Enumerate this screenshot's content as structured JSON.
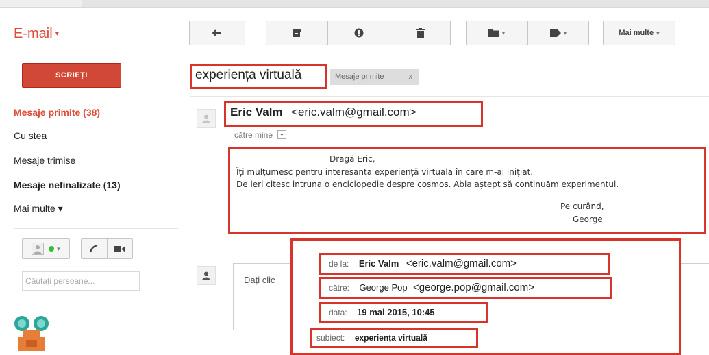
{
  "app": {
    "brand": "E-mail",
    "brand_caret": "▾"
  },
  "toolbar": {
    "more_label": "Mai multe",
    "more_caret": "▾",
    "caret": "▾",
    "icons": [
      "reply-arrow-icon",
      "archive-icon",
      "report-spam-icon",
      "trash-icon",
      "folder-icon",
      "label-tag-icon"
    ]
  },
  "sidebar": {
    "compose_label": "SCRIEȚI",
    "items": [
      {
        "label": "Mesaje primite (38)"
      },
      {
        "label": "Cu stea"
      },
      {
        "label": "Mesaje trimise"
      },
      {
        "label": "Mesaje nefinalizate (13)"
      },
      {
        "label": "Mai multe ▾"
      }
    ],
    "contacts_search_placeholder": "Căutați persoane..."
  },
  "conversation": {
    "subject": "experiența virtuală",
    "label_chip": "Mesaje primite",
    "label_chip_close": "x"
  },
  "message": {
    "sender_name": "Eric Valm",
    "sender_email": "<eric.valm@gmail.com>",
    "to_line": "către mine",
    "body": [
      "Dragă Eric,",
      "Îți mulțumesc pentru interesanta experiență virtuală în care m-ai inițiat.",
      "De ieri citesc intruna o enciclopedie despre cosmos. Abia aștept să continuăm experimentul.",
      "Pe curând,",
      "George"
    ]
  },
  "reply": {
    "placeholder": "Dați clic"
  },
  "details": {
    "from_label": "de la:",
    "from_name": "Eric Valm",
    "from_email": "<eric.valm@gmail.com>",
    "to_label": "către:",
    "to_name": "George Pop",
    "to_email": "<george.pop@gmail.com>",
    "date_label": "data:",
    "date_value": "19 mai 2015, 10:45",
    "subject_label": "subiect:",
    "subject_value": "experiența virtuală"
  },
  "colors": {
    "accent": "#dd4b39",
    "annotation": "#d9342b",
    "compose": "#d14836"
  }
}
